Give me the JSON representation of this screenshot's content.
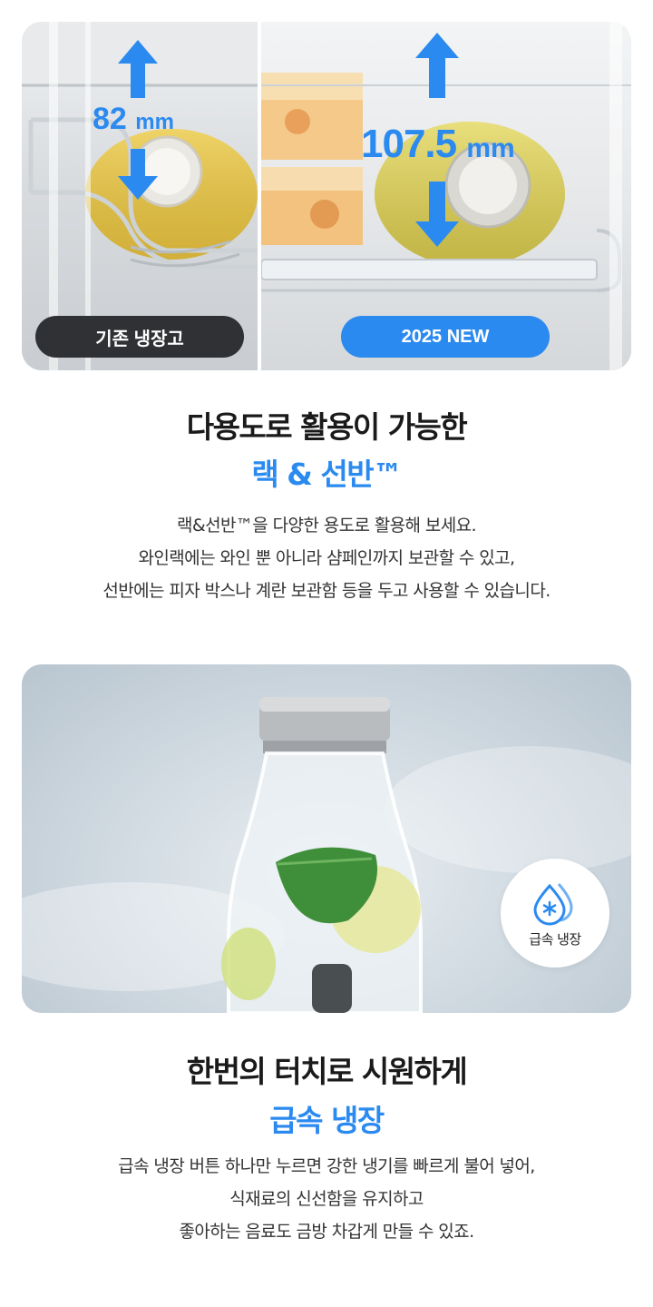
{
  "compare": {
    "old_label": "기존 냉장고",
    "new_label": "2025 NEW",
    "old_value": "82",
    "new_value": "107.5",
    "unit": "mm"
  },
  "section1": {
    "title": "다용도로 활용이 가능한",
    "subtitle": "랙 & 선반™",
    "description_lines": [
      "랙&선반™을 다양한 용도로 활용해 보세요.",
      "와인랙에는 와인 뿐 아니라 샴페인까지 보관할 수 있고,",
      "선반에는 피자 박스나 계란 보관함 등을 두고 사용할 수 있습니다."
    ]
  },
  "cooling_badge": {
    "label": "급속 냉장",
    "icon": "water-drop-snowflake-icon"
  },
  "section2": {
    "title": "한번의 터치로 시원하게",
    "subtitle": "급속 냉장",
    "description_lines": [
      "급속 냉장 버튼 하나만 누르면 강한 냉기를 빠르게 불어 넣어,",
      "식재료의 신선함을 유지하고",
      "좋아하는 음료도 금방 차갑게 만들 수 있죠."
    ]
  },
  "colors": {
    "accent": "#2b8af0",
    "dark_tag": "#2f3134",
    "text": "#1a1a1a"
  }
}
